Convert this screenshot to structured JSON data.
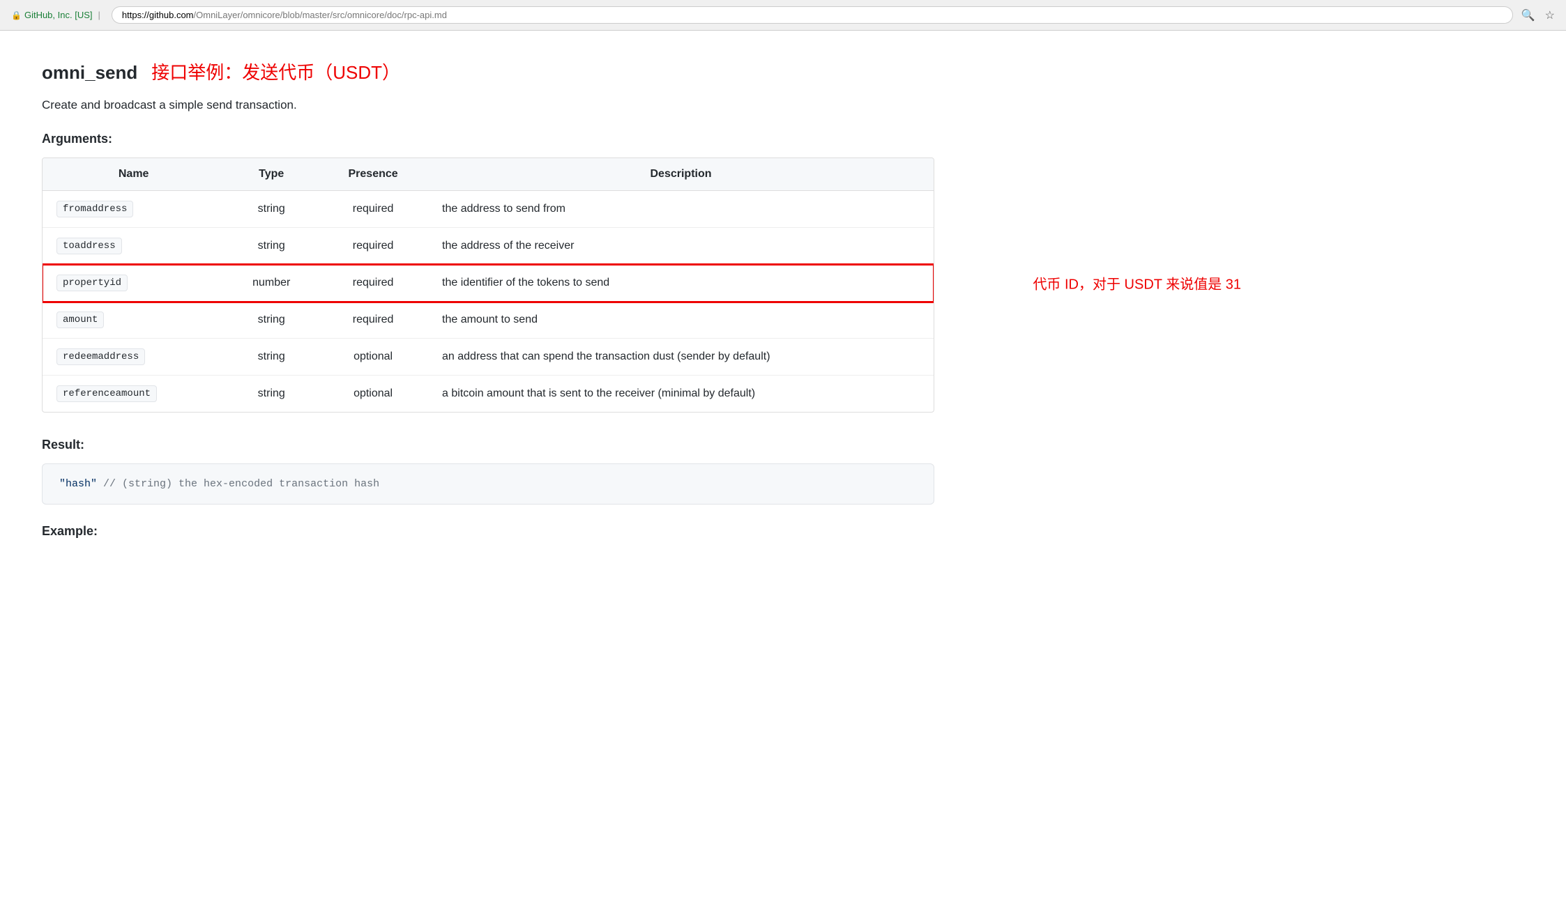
{
  "browser": {
    "security_label": "GitHub, Inc. [US]",
    "url_domain": "https://github.com",
    "url_path": "/OmniLayer/omnicore/blob/master/src/omnicore/doc/rpc-api.md",
    "search_icon": "🔍",
    "star_icon": "☆"
  },
  "api": {
    "name": "omni_send",
    "subtitle": "接口举例：发送代币（USDT）",
    "description": "Create and broadcast a simple send transaction."
  },
  "arguments": {
    "heading": "Arguments:",
    "table": {
      "columns": [
        "Name",
        "Type",
        "Presence",
        "Description"
      ],
      "rows": [
        {
          "name": "fromaddress",
          "type": "string",
          "presence": "required",
          "description": "the address to send from",
          "highlighted": false
        },
        {
          "name": "toaddress",
          "type": "string",
          "presence": "required",
          "description": "the address of the receiver",
          "highlighted": false
        },
        {
          "name": "propertyid",
          "type": "number",
          "presence": "required",
          "description": "the identifier of the tokens to send",
          "highlighted": true,
          "annotation": "代币 ID，对于 USDT 来说值是 31"
        },
        {
          "name": "amount",
          "type": "string",
          "presence": "required",
          "description": "the amount to send",
          "highlighted": false
        },
        {
          "name": "redeemaddress",
          "type": "string",
          "presence": "optional",
          "description": "an address that can spend the transaction dust (sender by default)",
          "highlighted": false
        },
        {
          "name": "referenceamount",
          "type": "string",
          "presence": "optional",
          "description": "a bitcoin amount that is sent to the receiver (minimal by default)",
          "highlighted": false
        }
      ]
    }
  },
  "result": {
    "heading": "Result:",
    "code": "\"hash\"  // (string) the hex-encoded transaction hash"
  },
  "example": {
    "heading": "Example:"
  }
}
